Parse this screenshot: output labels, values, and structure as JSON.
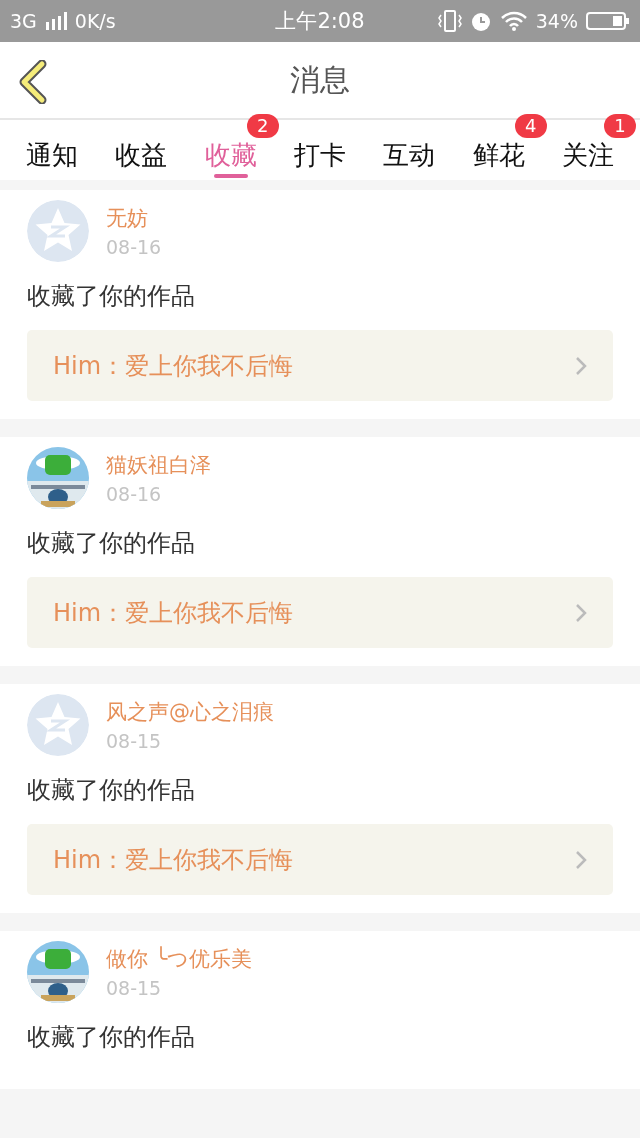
{
  "status_bar": {
    "network": "3G",
    "speed": "0K/s",
    "time": "上午2:08",
    "battery": "34%"
  },
  "header": {
    "title": "消息"
  },
  "tabs": [
    {
      "label": "通知",
      "selected": false
    },
    {
      "label": "收益",
      "selected": false
    },
    {
      "label": "收藏",
      "selected": true,
      "badge": "2"
    },
    {
      "label": "打卡",
      "selected": false
    },
    {
      "label": "互动",
      "selected": false
    },
    {
      "label": "鲜花",
      "selected": false,
      "badge": "4"
    },
    {
      "label": "关注",
      "selected": false,
      "badge": "1"
    }
  ],
  "messages": [
    {
      "avatar": {
        "kind": "default"
      },
      "name": "无妨",
      "date": "08-16",
      "text": "收藏了你的作品",
      "work": "Him：爱上你我不后悔"
    },
    {
      "name": "猫妖祖白泽",
      "date": "08-16",
      "text": "收藏了你的作品",
      "work": "Him：爱上你我不后悔"
    },
    {
      "avatar": {
        "kind": "default"
      },
      "name": "风之声@心之泪痕",
      "date": "08-15",
      "text": "收藏了你的作品",
      "work": "Him：爱上你我不后悔"
    },
    {
      "name": "做你 ╰つ优乐美",
      "date": "08-15",
      "text": "收藏了你的作品"
    }
  ]
}
